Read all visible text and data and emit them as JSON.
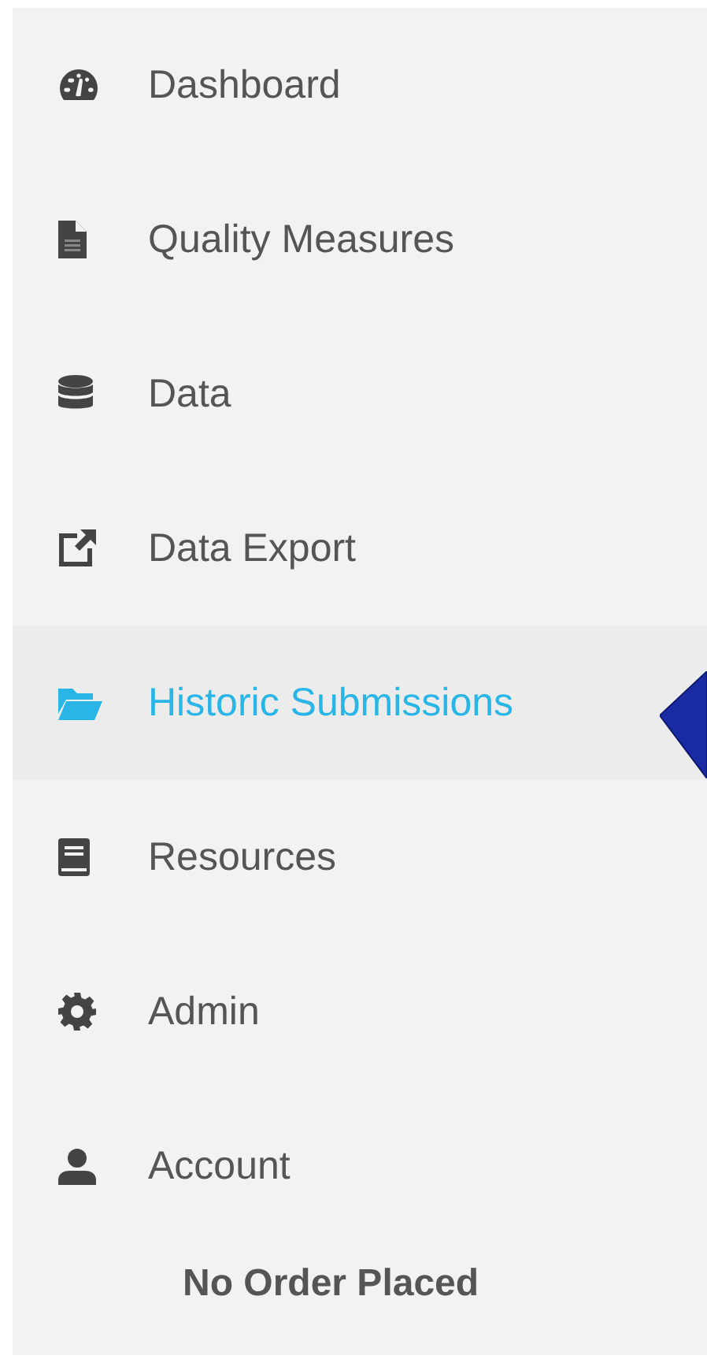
{
  "sidebar": {
    "items": [
      {
        "label": "Dashboard",
        "selected": false
      },
      {
        "label": "Quality Measures",
        "selected": false
      },
      {
        "label": "Data",
        "selected": false
      },
      {
        "label": "Data Export",
        "selected": false
      },
      {
        "label": "Historic Submissions",
        "selected": true
      },
      {
        "label": "Resources",
        "selected": false
      },
      {
        "label": "Admin",
        "selected": false
      },
      {
        "label": "Account",
        "selected": false
      }
    ],
    "order_status": "No Order Placed"
  }
}
